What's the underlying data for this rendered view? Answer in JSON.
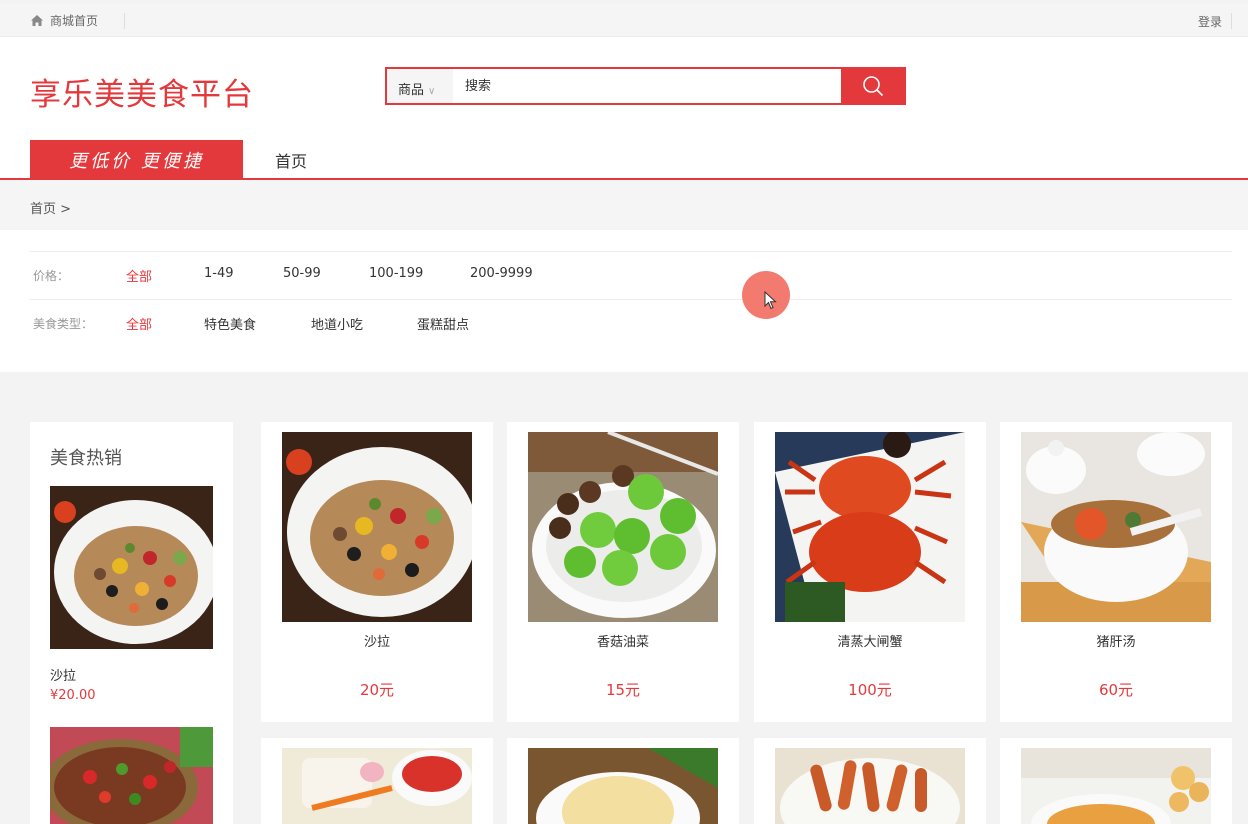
{
  "topbar": {
    "home_label": "商城首页",
    "login_label": "登录"
  },
  "header": {
    "logo": "享乐美美食平台",
    "search": {
      "category": "商品",
      "placeholder": "搜索"
    },
    "slogan": "更低价 更便捷",
    "nav_home": "首页"
  },
  "breadcrumb": {
    "text": "首页 >"
  },
  "filters": {
    "price": {
      "label": "价格：",
      "options": [
        "全部",
        "1-49",
        "50-99",
        "100-199",
        "200-9999"
      ],
      "selected": "全部"
    },
    "type": {
      "label": "美食类型：",
      "options": [
        "全部",
        "特色美食",
        "地道小吃",
        "蛋糕甜点"
      ],
      "selected": "全部"
    }
  },
  "sidebar": {
    "title": "美食热销",
    "items": [
      {
        "name": "沙拉",
        "price": "¥20.00"
      }
    ]
  },
  "products": [
    {
      "name": "沙拉",
      "price": "20元"
    },
    {
      "name": "香菇油菜",
      "price": "15元"
    },
    {
      "name": "清蒸大闸蟹",
      "price": "100元"
    },
    {
      "name": "猪肝汤",
      "price": "60元"
    }
  ],
  "colors": {
    "accent": "#e4393c",
    "page_bg": "#f3f3f3"
  }
}
